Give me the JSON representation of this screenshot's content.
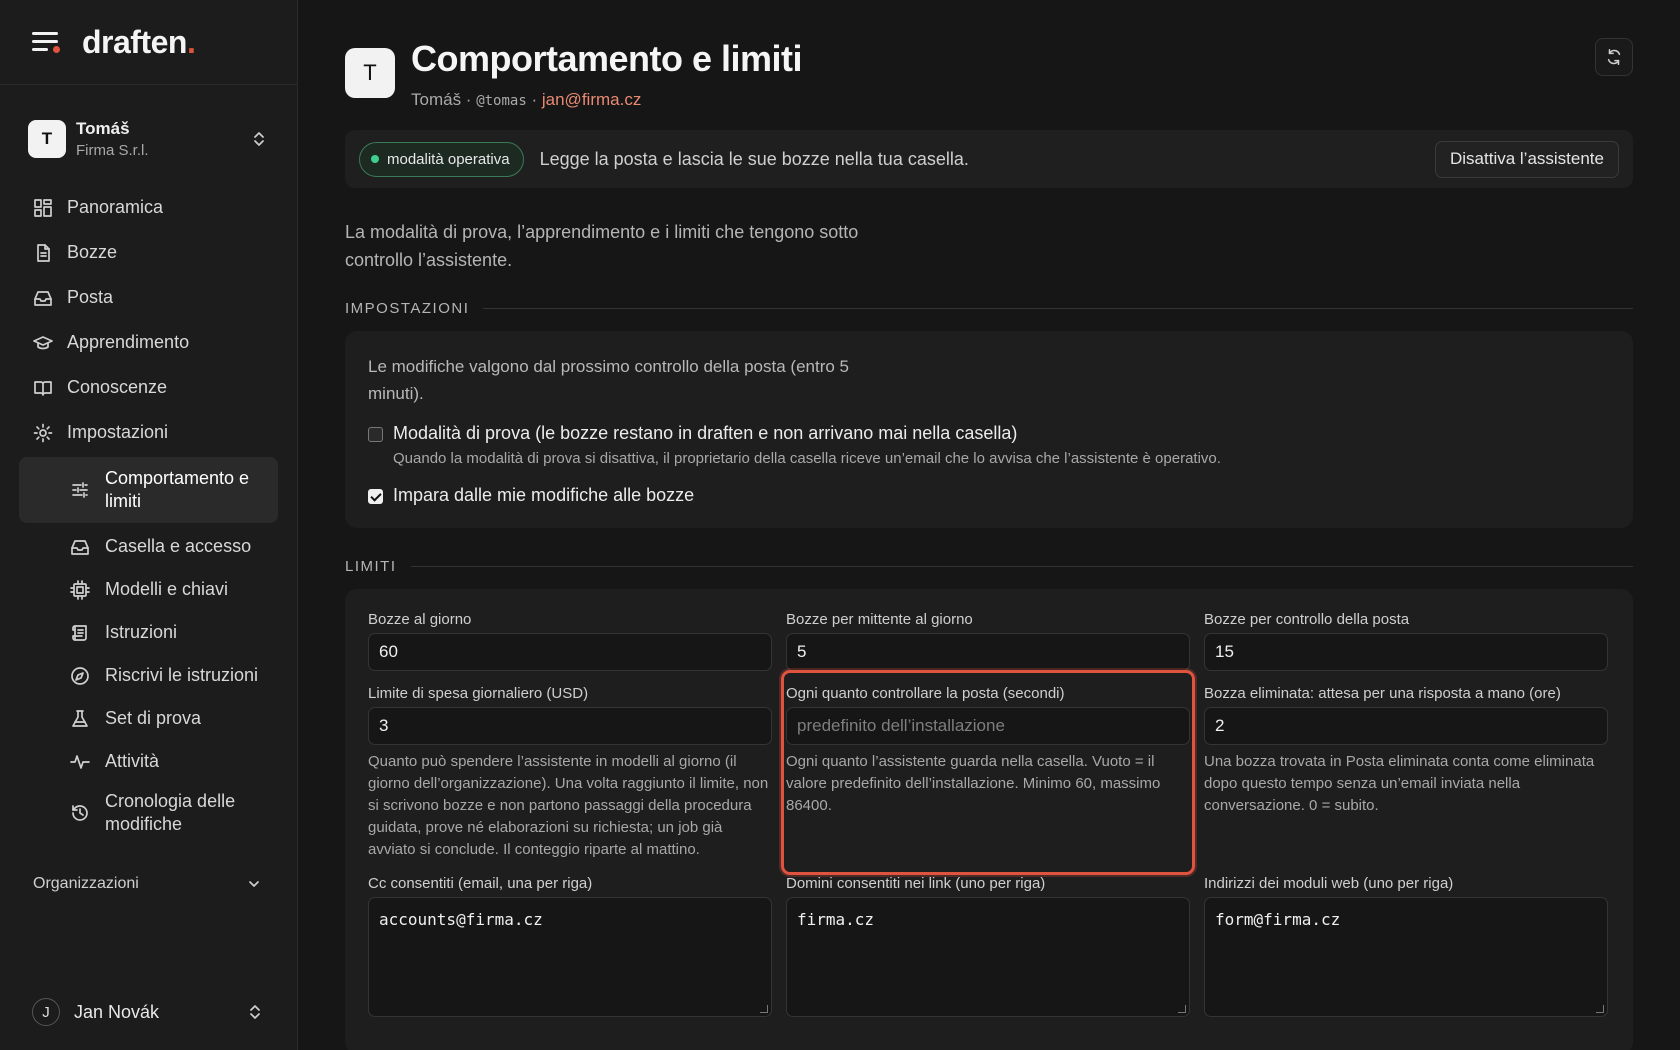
{
  "brand": {
    "name": "draften",
    "dot": "."
  },
  "org_switch": {
    "initial": "T",
    "name": "Tomáš",
    "company": "Firma S.r.l."
  },
  "nav": {
    "items": [
      {
        "label": "Panoramica",
        "icon": "grid-icon"
      },
      {
        "label": "Bozze",
        "icon": "document-icon"
      },
      {
        "label": "Posta",
        "icon": "inbox-icon"
      },
      {
        "label": "Apprendimento",
        "icon": "graduation-cap-icon"
      },
      {
        "label": "Conoscenze",
        "icon": "book-icon"
      },
      {
        "label": "Impostazioni",
        "icon": "gear-icon"
      }
    ],
    "sub_items": [
      {
        "label": "Comportamento e limiti",
        "icon": "sliders-icon",
        "active": true
      },
      {
        "label": "Casella e accesso",
        "icon": "inbox-icon"
      },
      {
        "label": "Modelli e chiavi",
        "icon": "chip-icon"
      },
      {
        "label": "Istruzioni",
        "icon": "scroll-icon"
      },
      {
        "label": "Riscrivi le istruzioni",
        "icon": "compass-icon"
      },
      {
        "label": "Set di prova",
        "icon": "flask-icon"
      },
      {
        "label": "Attività",
        "icon": "activity-icon"
      },
      {
        "label": "Cronologia delle modifiche",
        "icon": "history-icon"
      }
    ],
    "organizations_label": "Organizzazioni"
  },
  "user": {
    "initial": "J",
    "name": "Jan Novák"
  },
  "header": {
    "initial": "T",
    "title": "Comportamento e limiti",
    "name": "Tomáš",
    "sep1": " · ",
    "handle": "@tomas",
    "sep2": " · ",
    "email": "jan@firma.cz"
  },
  "status": {
    "pill": "modalità operativa",
    "text": "Legge la posta e lascia le sue bozze nella tua casella.",
    "button": "Disattiva l’assistente",
    "accent": "#3ecf8e"
  },
  "intro": "La modalità di prova, l’apprendimento e i limiti che tengono sotto controllo l’assistente.",
  "settings": {
    "heading": "IMPOSTAZIONI",
    "note": "Le modifiche valgono dal prossimo controllo della posta (entro 5 minuti).",
    "trial": {
      "label": "Modalità di prova (le bozze restano in draften e non arrivano mai nella casella)",
      "help": "Quando la modalità di prova si disattiva, il proprietario della casella riceve un’email che lo avvisa che l’assistente è operativo.",
      "checked": false
    },
    "learn": {
      "label": "Impara dalle mie modifiche alle bozze",
      "checked": true
    }
  },
  "limits": {
    "heading": "LIMITI",
    "drafts_per_day": {
      "label": "Bozze al giorno",
      "value": "60"
    },
    "drafts_per_sender": {
      "label": "Bozze per mittente al giorno",
      "value": "5"
    },
    "drafts_per_check": {
      "label": "Bozze per controllo della posta",
      "value": "15"
    },
    "spend_limit": {
      "label": "Limite di spesa giornaliero (USD)",
      "value": "3",
      "help": "Quanto può spendere l’assistente in modelli al giorno (il giorno dell’organizzazione). Una volta raggiunto il limite, non si scrivono bozze e non partono passaggi della procedura guidata, prove né elaborazioni su richiesta; un job già avviato si conclude. Il conteggio riparte al mattino."
    },
    "poll_interval": {
      "label": "Ogni quanto controllare la posta (secondi)",
      "placeholder": "predefinito dell’installazione",
      "help": "Ogni quanto l’assistente guarda nella casella. Vuoto = il valore predefinito dell’installazione. Minimo 60, massimo 86400."
    },
    "deleted_wait": {
      "label": "Bozza eliminata: attesa per una risposta a mano (ore)",
      "value": "2",
      "help": "Una bozza trovata in Posta eliminata conta come eliminata dopo questo tempo senza un’email inviata nella conversazione. 0 = subito."
    },
    "cc_allowed": {
      "label": "Cc consentiti (email, una per riga)",
      "value": "accounts@firma.cz"
    },
    "link_domains": {
      "label": "Domini consentiti nei link (uno per riga)",
      "value": "firma.cz"
    },
    "web_forms": {
      "label": "Indirizzi dei moduli web (uno per riga)",
      "value": "form@firma.cz"
    }
  },
  "colors": {
    "accent": "#e0533e",
    "background": "#161616"
  }
}
